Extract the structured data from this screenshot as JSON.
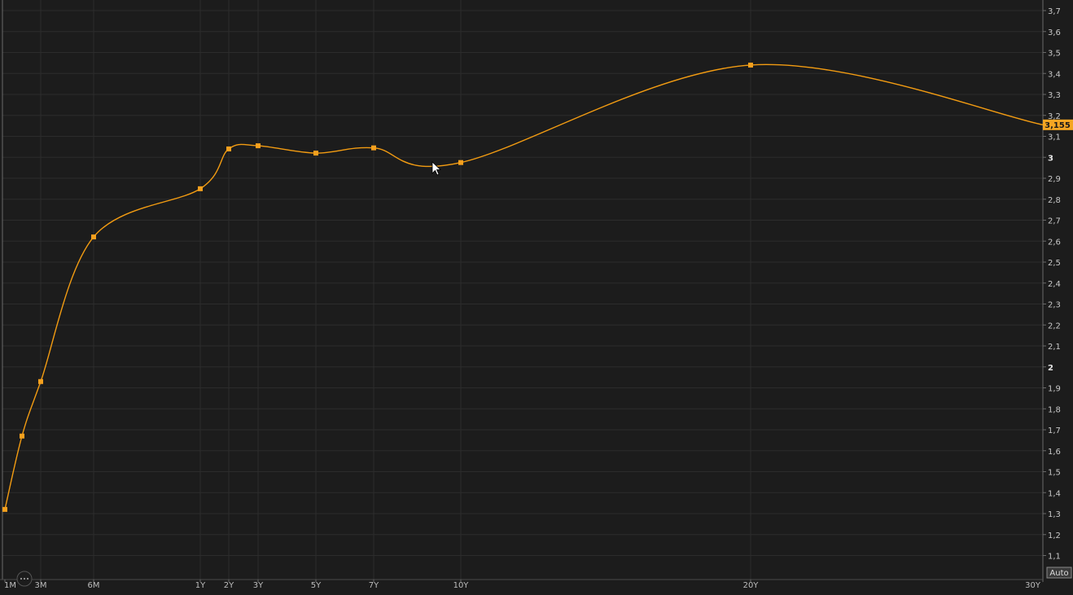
{
  "chart_data": {
    "type": "line",
    "title": "",
    "xlabel": "",
    "ylabel": "",
    "ylim": [
      1.03,
      3.75
    ],
    "grid": true,
    "x_tick_labels": [
      "1M",
      "3M",
      "6M",
      "1Y",
      "2Y",
      "3Y",
      "5Y",
      "7Y",
      "10Y",
      "20Y",
      "30Y"
    ],
    "y_tick_labels": [
      "1,1",
      "1,2",
      "1,3",
      "1,4",
      "1,5",
      "1,6",
      "1,7",
      "1,8",
      "1,9",
      "2",
      "2,1",
      "2,2",
      "2,3",
      "2,4",
      "2,5",
      "2,6",
      "2,7",
      "2,8",
      "2,9",
      "3",
      "3,1",
      "3,2",
      "3,3",
      "3,4",
      "3,5",
      "3,6",
      "3,7"
    ],
    "y_ticks": [
      1.1,
      1.2,
      1.3,
      1.4,
      1.5,
      1.6,
      1.7,
      1.8,
      1.9,
      2.0,
      2.1,
      2.2,
      2.3,
      2.4,
      2.5,
      2.6,
      2.7,
      2.8,
      2.9,
      3.0,
      3.1,
      3.2,
      3.3,
      3.4,
      3.5,
      3.6,
      3.7
    ],
    "y_bold_ticks": [
      2.0,
      3.0
    ],
    "series": [
      {
        "points": [
          {
            "x": "1M",
            "y": 1.32
          },
          {
            "x": "2M",
            "y": 1.67
          },
          {
            "x": "3M",
            "y": 1.93
          },
          {
            "x": "6M",
            "y": 2.62
          },
          {
            "x": "1Y",
            "y": 2.85
          },
          {
            "x": "2Y",
            "y": 3.04
          },
          {
            "x": "3Y",
            "y": 3.055
          },
          {
            "x": "5Y",
            "y": 3.02
          },
          {
            "x": "7Y",
            "y": 3.045
          },
          {
            "x": "10Y",
            "y": 2.975
          },
          {
            "x": "20Y",
            "y": 3.44
          },
          {
            "x": "30Y",
            "y": 3.155
          }
        ],
        "color": "#f39c12"
      }
    ],
    "last_value_label": "3,155",
    "scale_button": "Auto",
    "menu_icon": "more-dots-icon",
    "colors": {
      "background": "#1c1c1c",
      "grid": "#2c2c2c",
      "line": "#f39c12",
      "marker": "#f5a01e",
      "last_value_badge": "#f5a623"
    }
  }
}
